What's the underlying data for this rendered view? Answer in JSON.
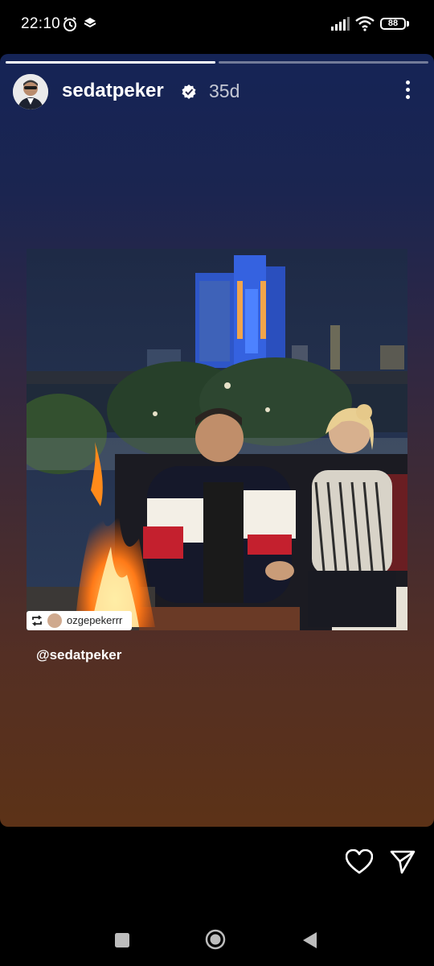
{
  "status_bar": {
    "time": "22:10",
    "battery": "88",
    "icons": [
      "alarm-icon",
      "layers-icon",
      "signal-icon",
      "wifi-icon",
      "battery-icon"
    ]
  },
  "story": {
    "progress": [
      1.0,
      0.0
    ],
    "username": "sedatpeker",
    "time_ago": "35d",
    "verified": true,
    "repost_username": "ozgepekerrr",
    "mention": "@sedatpeker"
  },
  "actions": {
    "icons": [
      "heart-icon",
      "send-icon"
    ]
  },
  "nav": {
    "icons": [
      "recents-icon",
      "home-icon",
      "back-icon"
    ]
  },
  "colors": {
    "accent_blue": "#2d5bff",
    "fire": "#ff8a1a"
  }
}
